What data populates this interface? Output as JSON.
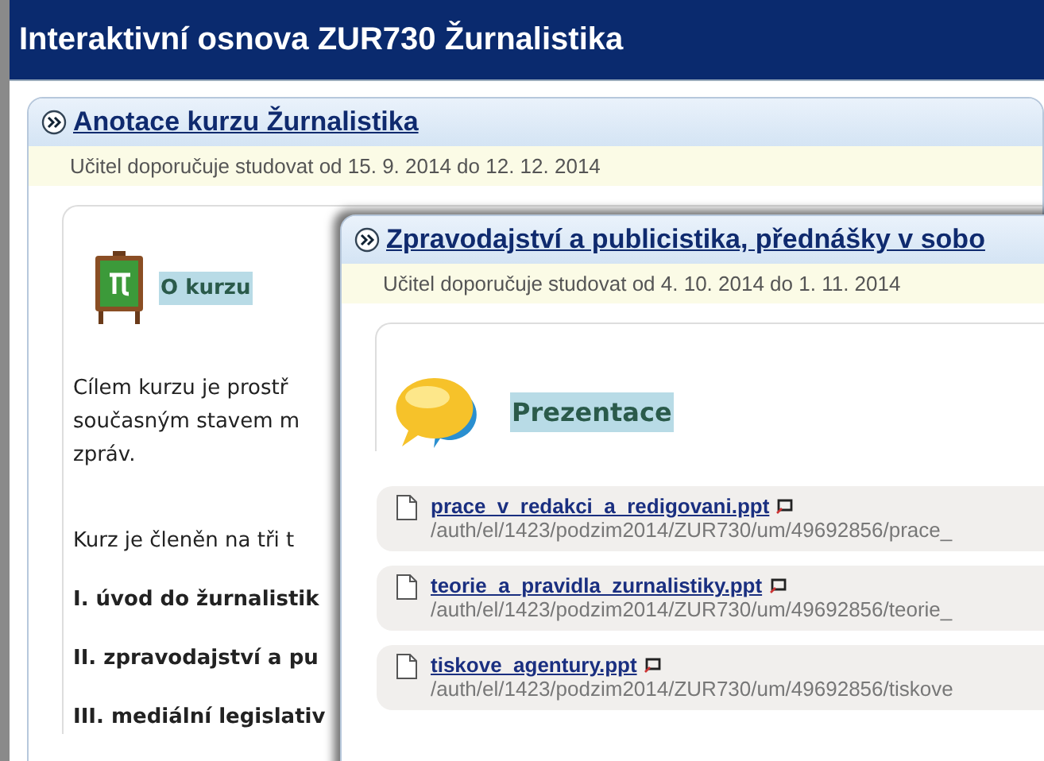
{
  "header": {
    "title": "Interaktivní osnova ZUR730 Žurnalistika"
  },
  "section": {
    "title": "Anotace kurzu Žurnalistika",
    "dates": "Učitel doporučuje studovat od 15. 9. 2014 do 12. 12. 2014",
    "card_title": "O kurzu",
    "paragraphs": [
      {
        "kind": "plain",
        "text": "Cílem kurzu je prostř"
      },
      {
        "kind": "plain",
        "text": "současným stavem m"
      },
      {
        "kind": "plain",
        "text": "zpráv."
      },
      {
        "kind": "gap",
        "text": "Kurz je členěn na tři t"
      },
      {
        "kind": "bold",
        "text": "I. úvod do žurnalistik"
      },
      {
        "kind": "bold",
        "text": "II. zpravodajství a pu"
      },
      {
        "kind": "bold",
        "text": "III. mediální legislativ"
      }
    ]
  },
  "popup": {
    "title": "Zpravodajství a publicistika, přednášky v sobo",
    "dates": "Učitel doporučuje studovat od 4. 10. 2014 do 1. 11. 2014",
    "card_title": "Prezentace",
    "files": [
      {
        "name": "prace_v_redakci_a_redigovani.ppt",
        "path": "/auth/el/1423/podzim2014/ZUR730/um/49692856/prace_"
      },
      {
        "name": "teorie_a_pravidla_zurnalistiky.ppt",
        "path": "/auth/el/1423/podzim2014/ZUR730/um/49692856/teorie_"
      },
      {
        "name": "tiskove_agentury.ppt",
        "path": "/auth/el/1423/podzim2014/ZUR730/um/49692856/tiskove"
      }
    ]
  }
}
